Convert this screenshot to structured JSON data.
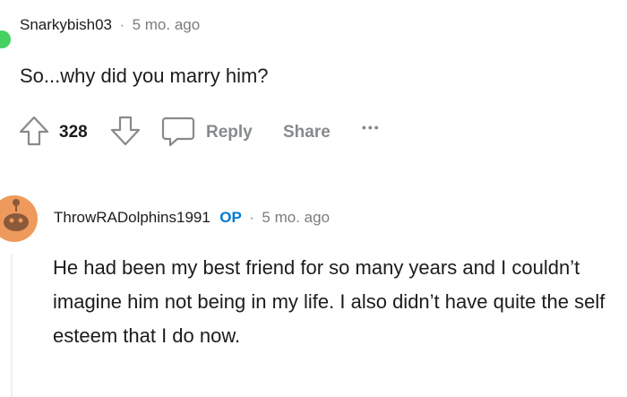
{
  "comment1": {
    "username": "Snarkybish03",
    "separator": "·",
    "time": "5 mo. ago",
    "body": "So...why did you marry him?",
    "votes": "328",
    "reply_label": "Reply",
    "share_label": "Share",
    "more_label": "•••"
  },
  "comment2": {
    "username": "ThrowRADolphins1991",
    "op_badge": "OP",
    "separator": "·",
    "time": "5 mo. ago",
    "body": "He had been my best friend for so many years and I couldn’t imagine him not being in my life. I also didn’t have quite the self esteem that I do now."
  },
  "colors": {
    "online_indicator": "#46d160",
    "op_badge": "#0079d3",
    "avatar": "#ee9a5c",
    "muted": "#878a8c"
  },
  "icons": [
    "upvote-icon",
    "downvote-icon",
    "reply-icon",
    "snoo-avatar-icon"
  ]
}
